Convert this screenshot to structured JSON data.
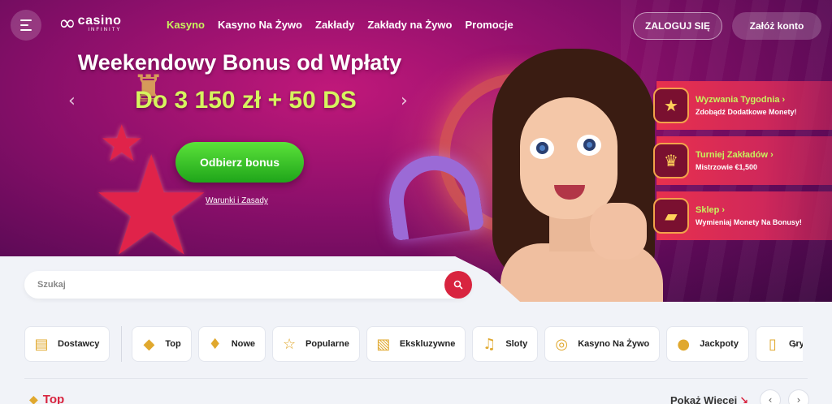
{
  "header": {
    "logo": {
      "main": "casino",
      "sub": "INFINITY"
    },
    "nav": [
      {
        "label": "Kasyno",
        "active": true
      },
      {
        "label": "Kasyno Na Żywo"
      },
      {
        "label": "Zakłady"
      },
      {
        "label": "Zakłady na Żywo"
      },
      {
        "label": "Promocje"
      }
    ],
    "login_label": "ZALOGUJ SIĘ",
    "register_label": "Załóż konto"
  },
  "promo": {
    "title": "Weekendowy Bonus od Wpłaty",
    "amount": "Do 3 150 zł + 50 DS",
    "cta_label": "Odbierz bonus",
    "terms_label": "Warunki i Zasady"
  },
  "side_promos": [
    {
      "title": "Wyzwania Tygodnia",
      "subtitle": "Zdobądź Dodatkowe Monety!",
      "icon": "star-trophy-icon"
    },
    {
      "title": "Turniej Zakładów",
      "subtitle": "Mistrzowie €1,500",
      "icon": "trophy-icon"
    },
    {
      "title": "Sklep",
      "subtitle": "Wymieniaj Monety Na Bonusy!",
      "icon": "shop-card-icon"
    }
  ],
  "search": {
    "placeholder": "Szukaj"
  },
  "categories": [
    {
      "label": "Dostawcy",
      "icon": "providers-icon"
    },
    {
      "label": "Top",
      "icon": "top-icon"
    },
    {
      "label": "Nowe",
      "icon": "new-icon"
    },
    {
      "label": "Popularne",
      "icon": "star-icon"
    },
    {
      "label": "Ekskluzywne",
      "icon": "exclusive-icon"
    },
    {
      "label": "Sloty",
      "icon": "bell-icon"
    },
    {
      "label": "Kasyno Na Żywo",
      "icon": "roulette-icon"
    },
    {
      "label": "Jackpoty",
      "icon": "coins-icon"
    },
    {
      "label": "Gry Stoło",
      "icon": "cards-icon"
    }
  ],
  "section": {
    "title": "Top",
    "show_more_label": "Pokaż Więcej"
  },
  "colors": {
    "accent": "#d8243f",
    "active_nav": "#c8f25e",
    "cta_green": "#2bb523",
    "hero_bg": "#8a0f6a"
  }
}
